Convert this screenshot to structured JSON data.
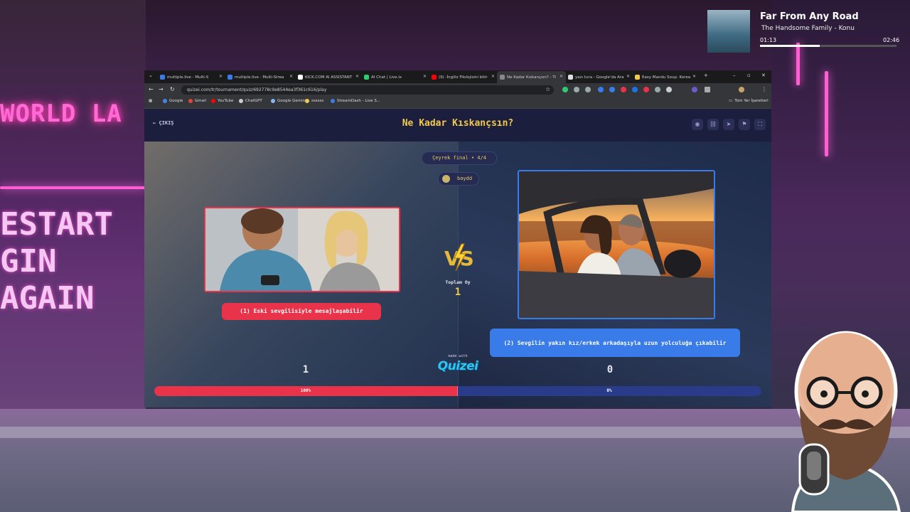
{
  "background": {
    "neon_sign": "WORLD LA",
    "restart_sign_line1": "ESTART",
    "restart_sign_line2": "GIN AGAIN"
  },
  "music": {
    "title": "Far From Any Road",
    "artist": "The Handsome Family - Konu",
    "elapsed": "01:13",
    "duration": "02:46",
    "progress": 0.44
  },
  "browser": {
    "tabs": [
      {
        "label": "multiple.live - Multi-S",
        "color": "#3a7bea",
        "active": false
      },
      {
        "label": "multiple.live - Multi-Strea",
        "color": "#3a7bea",
        "active": false
      },
      {
        "label": "KICK.COM AI ASSISTANT",
        "color": "#ffffff",
        "active": false
      },
      {
        "label": "AI Chat | Live.ix",
        "color": "#2ecc71",
        "active": false
      },
      {
        "label": "(9) -İngiliz Filolojisini bitir",
        "color": "#ff0000",
        "active": false
      },
      {
        "label": "Ne Kadar Kıskançsın? - Ti",
        "color": "#888888",
        "active": true
      },
      {
        "label": "yazı tura - Google'da Ara",
        "color": "#dddddd",
        "active": false
      },
      {
        "label": "Easy Mandu Soup: Korea",
        "color": "#f2c94c",
        "active": false
      }
    ],
    "url": "quizei.com/tr/tournament/quiz/692778c9e8544ea3f361c616/play",
    "bookmarks": [
      {
        "label": "Google",
        "color": "#4285f4"
      },
      {
        "label": "Gmail",
        "color": "#ea4335"
      },
      {
        "label": "YouTube",
        "color": "#ff0000"
      },
      {
        "label": "ChatGPT",
        "color": "#cccccc"
      },
      {
        "label": "Google Gemini",
        "color": "#8ab4f8"
      },
      {
        "label": "ssssss",
        "color": "#f2c94c"
      },
      {
        "label": "StreamDash - Live S...",
        "color": "#3a7bea"
      }
    ],
    "all_bookmarks": "Tüm Yer İşaretleri"
  },
  "quiz": {
    "exit_label": "ÇIKIŞ",
    "title": "Ne Kadar Kıskançsın?",
    "round": "Çeyrek final • 4/4",
    "username": "baydd",
    "option1": "(1) Eski sevgilisiyle mesajlaşabilir",
    "option2": "(2) Sevgilin yakın kız/erkek arkadaşıyla uzun yolculuğa çıkabilir",
    "total_votes_label": "Toplam Oy",
    "total_votes": "1",
    "count1": "1",
    "count2": "0",
    "made_with": "made with",
    "logo": "Quizei",
    "pct1_label": "100%",
    "pct2_label": "0%",
    "pct1": 1.0,
    "colors": {
      "accent": "#f2c94c",
      "red": "#e8334a",
      "blue": "#3a7bea"
    }
  }
}
